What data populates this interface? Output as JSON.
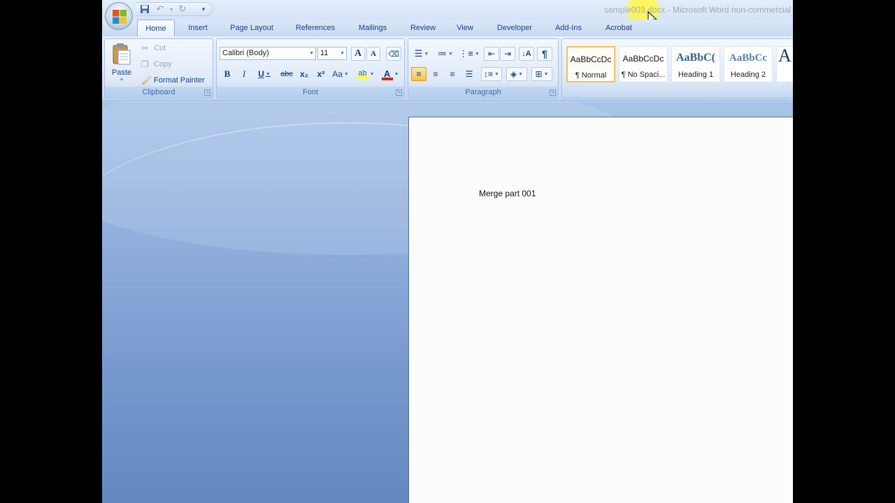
{
  "window": {
    "title_doc": "sample003.docx",
    "title_app": " - Microsoft Word non-commercial use"
  },
  "tabs": [
    {
      "label": "Home",
      "active": true
    },
    {
      "label": "Insert"
    },
    {
      "label": "Page Layout"
    },
    {
      "label": "References"
    },
    {
      "label": "Mailings"
    },
    {
      "label": "Review"
    },
    {
      "label": "View"
    },
    {
      "label": "Developer"
    },
    {
      "label": "Add-Ins"
    },
    {
      "label": "Acrobat"
    }
  ],
  "clipboard": {
    "group_label": "Clipboard",
    "paste": "Paste",
    "cut": "Cut",
    "copy": "Copy",
    "format_painter": "Format Painter"
  },
  "font": {
    "group_label": "Font",
    "family": "Calibri (Body)",
    "size": "11",
    "bold": "B",
    "italic": "I",
    "underline": "U",
    "strikethrough": "abc",
    "subscript": "x₂",
    "superscript": "x²",
    "change_case": "Aa",
    "font_color": "A",
    "grow": "A",
    "shrink": "A"
  },
  "paragraph": {
    "group_label": "Paragraph",
    "show_marks": "¶"
  },
  "styles": {
    "items": [
      {
        "sample": "AaBbCcDc",
        "name": "¶ Normal",
        "selected": true
      },
      {
        "sample": "AaBbCcDc",
        "name": "¶ No Spaci..."
      },
      {
        "sample": "AaBbC(",
        "name": "Heading 1"
      },
      {
        "sample": "AaBbCc",
        "name": "Heading 2"
      },
      {
        "sample": "A",
        "name": ""
      }
    ]
  },
  "document": {
    "text": "Merge part 001"
  },
  "colors": {
    "ribbon_text": "#15428b",
    "highlight": "#ffff33",
    "font_color_bar": "#e02020"
  }
}
